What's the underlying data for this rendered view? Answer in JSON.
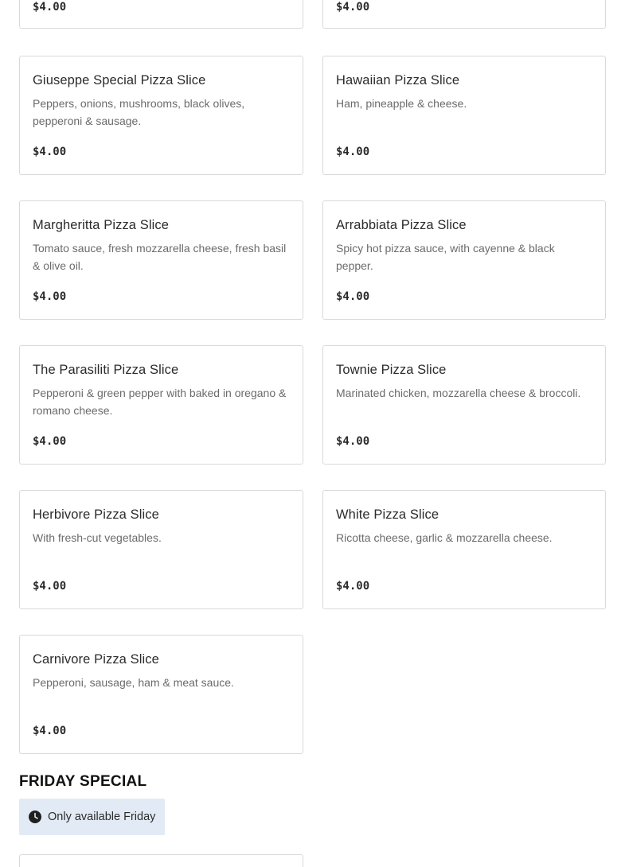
{
  "items": [
    {
      "name": "",
      "desc": "",
      "price": "$4.00"
    },
    {
      "name": "",
      "desc": "",
      "price": "$4.00"
    },
    {
      "name": "Giuseppe Special Pizza Slice",
      "desc": "Peppers, onions, mushrooms, black olives, pepperoni & sausage.",
      "price": "$4.00"
    },
    {
      "name": "Hawaiian Pizza Slice",
      "desc": "Ham, pineapple & cheese.",
      "price": "$4.00"
    },
    {
      "name": "Margheritta Pizza Slice",
      "desc": "Tomato sauce, fresh mozzarella cheese, fresh basil & olive oil.",
      "price": "$4.00"
    },
    {
      "name": "Arrabbiata Pizza Slice",
      "desc": "Spicy hot pizza sauce, with cayenne & black pepper.",
      "price": "$4.00"
    },
    {
      "name": "The Parasiliti Pizza Slice",
      "desc": "Pepperoni & green pepper with baked in oregano & romano cheese.",
      "price": "$4.00"
    },
    {
      "name": "Townie Pizza Slice",
      "desc": "Marinated chicken, mozzarella cheese & broccoli.",
      "price": "$4.00"
    },
    {
      "name": "Herbivore Pizza Slice",
      "desc": "With fresh-cut vegetables.",
      "price": "$4.00"
    },
    {
      "name": "White Pizza Slice",
      "desc": "Ricotta cheese, garlic & mozzarella cheese.",
      "price": "$4.00"
    },
    {
      "name": "Carnivore Pizza Slice",
      "desc": "Pepperoni, sausage, ham & meat sauce.",
      "price": "$4.00"
    }
  ],
  "section": {
    "title": "FRIDAY SPECIAL",
    "availability": "Only available Friday",
    "availability_icon": "clock-icon"
  }
}
